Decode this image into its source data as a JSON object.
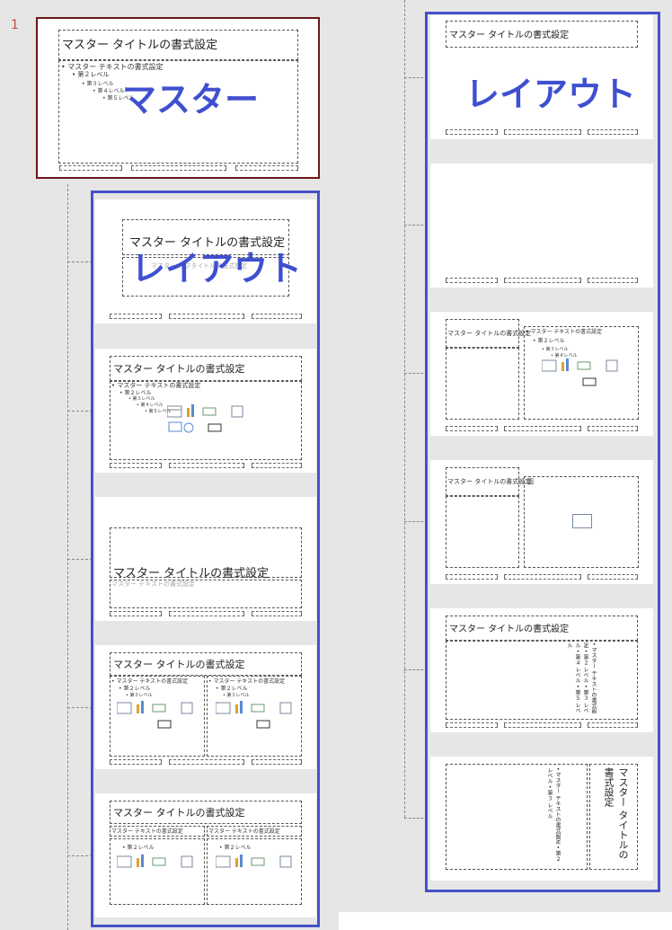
{
  "slide_number": "1",
  "master": {
    "title": "マスター タイトルの書式設定",
    "bullets": [
      "• マスター テキストの書式設定",
      "• 第２レベル",
      "• 第３レベル",
      "• 第４レベル",
      "• 第５レベル"
    ],
    "overlay": "マスター"
  },
  "overlay_layout": "レイアウト",
  "layouts_left": {
    "title_slide": {
      "title": "マスター タイトルの書式設定",
      "subtitle": "マスター サブタイトルの書式設定"
    },
    "title_content": {
      "title": "マスター タイトルの書式設定",
      "bullets": [
        "• マスター テキストの書式設定",
        "• 第２レベル",
        "• 第３レベル",
        "• 第４レベル",
        "• 第５レベル"
      ]
    },
    "section_header": {
      "title": "マスター タイトルの書式設定",
      "text": "マスター テキストの書式設定"
    },
    "two_content": {
      "title": "マスター タイトルの書式設定",
      "bullets": [
        "• マスター テキストの書式設定",
        "• 第２レベル",
        "• 第３レベル"
      ]
    },
    "comparison": {
      "title": "マスター タイトルの書式設定",
      "heading": "マスター テキストの書式設定",
      "bullets": [
        "マスター テキストの書式設定",
        "• 第２レベル",
        "• 第３レベル"
      ]
    }
  },
  "layouts_right": {
    "title_only": {
      "title": "マスター タイトルの書式設定"
    },
    "content_caption": {
      "title": "マスター タイトルの書式設定",
      "bullets": [
        "• マスター テキストの書式設定",
        "• 第２レベル",
        "• 第３レベル",
        "• 第４レベル"
      ]
    },
    "picture_caption": {
      "title": "マスター タイトルの書式設定",
      "picture_label": "図"
    },
    "vertical_text": {
      "title": "マスター タイトルの書式設定",
      "text": "• マスター テキストの書式設定 • 第２ レベル • 第３ レベル • 第４ レベル • 第５ レベル"
    },
    "vertical_title": {
      "title": "マスター タイトルの書式設定",
      "text": "• マスター テキストの書式設定 • 第２ レベル • 第３ レベル"
    }
  },
  "colors": {
    "selection_master": "#6b1818",
    "overlay_blue": "#3f4fcf",
    "panel_bg": "#e6e6e6"
  }
}
